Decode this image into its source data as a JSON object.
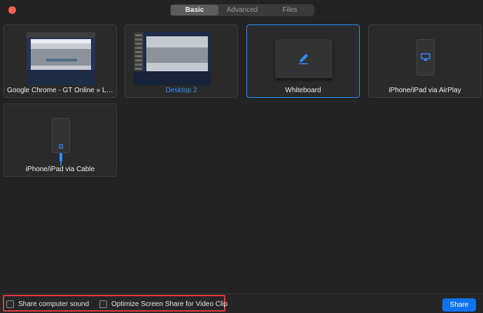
{
  "tabs": [
    {
      "label": "Basic"
    },
    {
      "label": "Advanced"
    },
    {
      "label": "Files"
    }
  ],
  "sources": [
    {
      "label": "Google Chrome - GT Online » Locate your local Internet provider"
    },
    {
      "label": "Desktop 2"
    },
    {
      "label": "Whiteboard"
    },
    {
      "label": "iPhone/iPad via AirPlay"
    },
    {
      "label": "iPhone/iPad via Cable"
    }
  ],
  "footer": {
    "share_sound_label": "Share computer sound",
    "optimize_label": "Optimize Screen Share for Video Clip",
    "share_button": "Share"
  },
  "colors": {
    "accent": "#2d8cff",
    "highlight_box": "#e0393e"
  }
}
